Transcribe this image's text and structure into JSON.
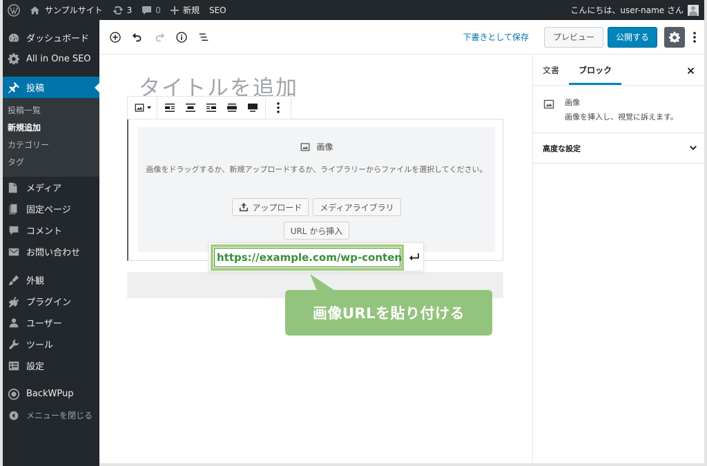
{
  "adminbar": {
    "site_name": "サンプルサイト",
    "updates_count": "3",
    "comments_count": "0",
    "new_label": "新規",
    "seo_label": "SEO",
    "greeting": "こんにちは、user-name さん"
  },
  "sidebar": {
    "items": [
      {
        "label": "ダッシュボード",
        "icon": "dashboard-icon"
      },
      {
        "label": "All in One SEO",
        "icon": "gear-icon"
      },
      {
        "label": "投稿",
        "icon": "pin-icon",
        "active": true
      },
      {
        "label": "メディア",
        "icon": "media-icon"
      },
      {
        "label": "固定ページ",
        "icon": "page-icon"
      },
      {
        "label": "コメント",
        "icon": "comment-icon"
      },
      {
        "label": "お問い合わせ",
        "icon": "mail-icon"
      },
      {
        "label": "外観",
        "icon": "brush-icon"
      },
      {
        "label": "プラグイン",
        "icon": "plugin-icon"
      },
      {
        "label": "ユーザー",
        "icon": "user-icon"
      },
      {
        "label": "ツール",
        "icon": "wrench-icon"
      },
      {
        "label": "設定",
        "icon": "settings-icon"
      },
      {
        "label": "BackWPup",
        "icon": "backwpup-icon"
      },
      {
        "label": "メニューを閉じる",
        "icon": "collapse-icon"
      }
    ],
    "submenu": [
      {
        "label": "投稿一覧"
      },
      {
        "label": "新規追加",
        "current": true
      },
      {
        "label": "カテゴリー"
      },
      {
        "label": "タグ"
      }
    ]
  },
  "header": {
    "save_draft": "下書きとして保存",
    "preview": "プレビュー",
    "publish": "公開する"
  },
  "editor": {
    "title_placeholder": "タイトルを追加",
    "image_block": {
      "label": "画像",
      "instructions": "画像をドラッグするか、新規アップロードするか、ライブラリーからファイルを選択してください。",
      "upload_button": "アップロード",
      "library_button": "メディアライブラリ",
      "insert_url_button": "URL から挿入",
      "url_value": "https://example.com/wp-content/"
    },
    "callout": "画像URLを貼り付ける"
  },
  "panel": {
    "tabs": [
      "文書",
      "ブロック"
    ],
    "active_tab": "ブロック",
    "block_title": "画像",
    "block_description": "画像を挿入し、視覚に訴えます。",
    "advanced": "高度な設定"
  },
  "colors": {
    "adminbar_bg": "#23282d",
    "active_menu": "#0073aa",
    "publish_button": "#0085ba",
    "callout_green": "#93c47d",
    "url_text_green": "#3a8e3a"
  }
}
